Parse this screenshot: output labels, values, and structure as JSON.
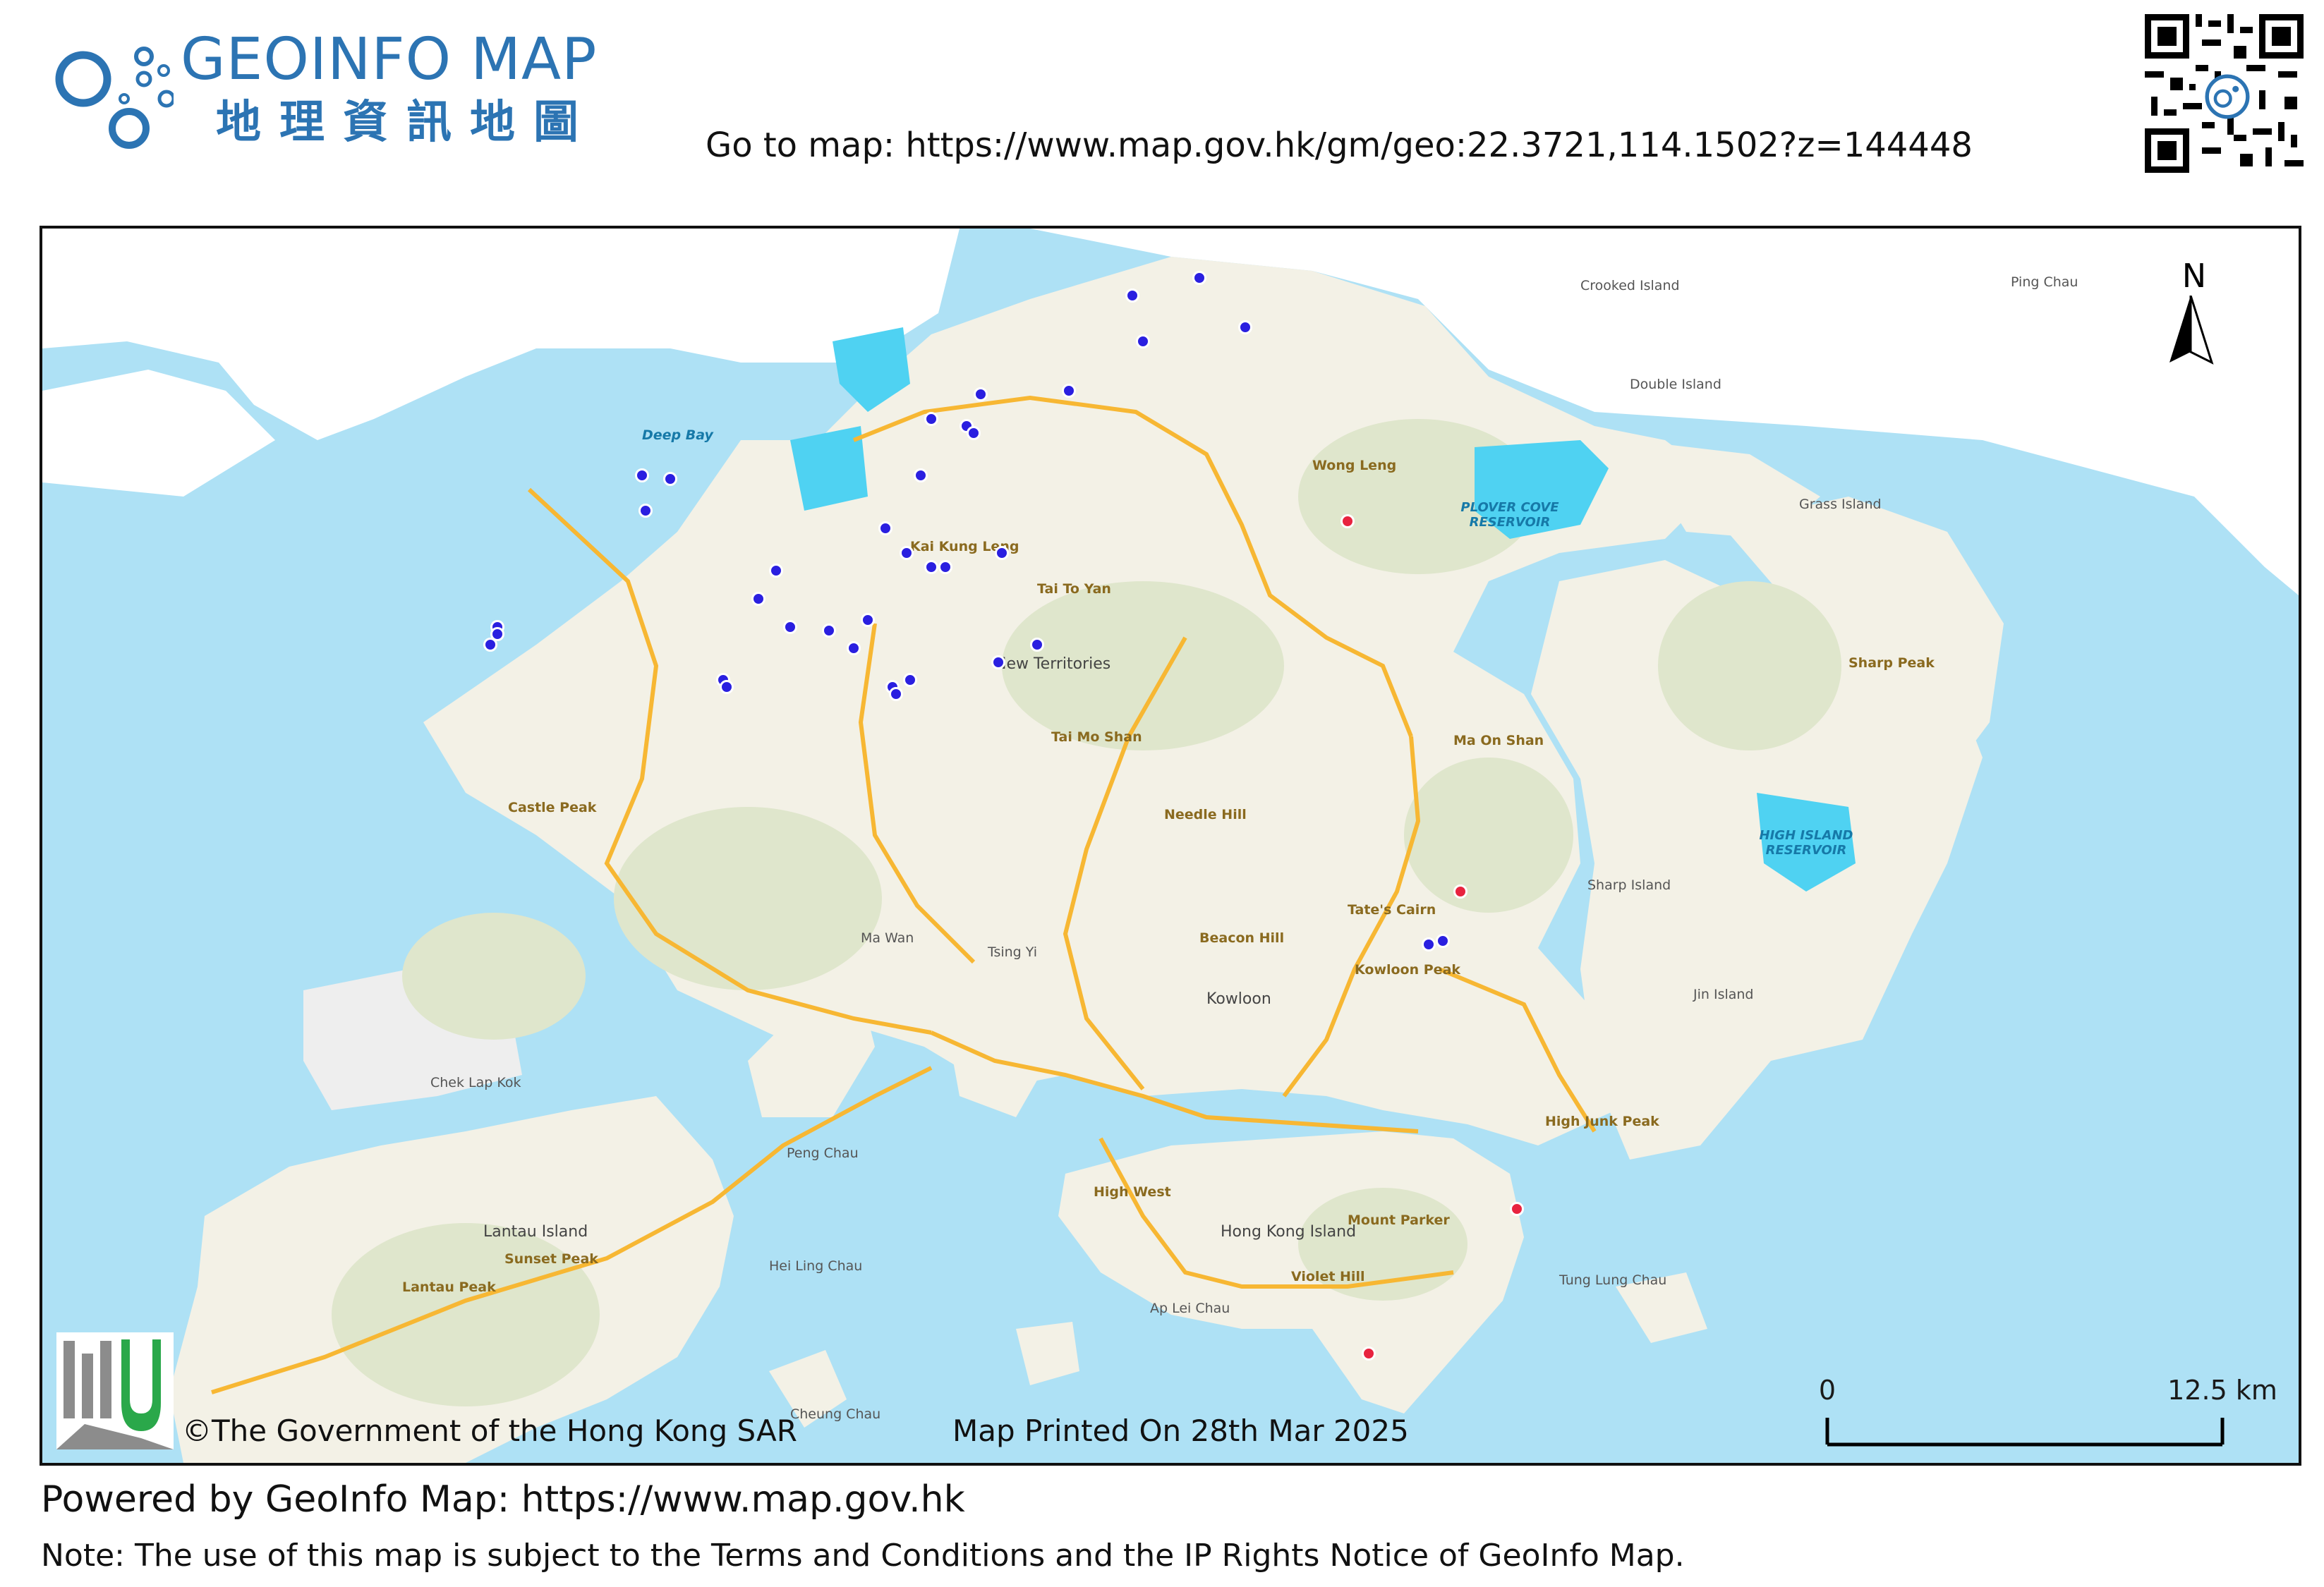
{
  "header": {
    "brand_en": "GEOINFO MAP",
    "brand_zh": "地理資訊地圖",
    "goto_label": "Go to map: https://www.map.gov.hk/gm/geo:22.3721,114.1502?z=144448",
    "qr_icon": "qr-code-icon"
  },
  "colors": {
    "brand": "#2c74b3",
    "sea": "#aee1f5",
    "land": "#f3f1e6",
    "green_hill": "#dfe6cc",
    "reservoir": "#4fd2f2",
    "road": "#f7b733",
    "blue_marker": "#2a1fe0",
    "red_marker": "#e8233f"
  },
  "map": {
    "labels": [
      {
        "text": "Deep Bay",
        "kind": "water"
      },
      {
        "text": "Kai Kung Leng",
        "kind": "peak"
      },
      {
        "text": "Tai To Yan",
        "kind": "peak"
      },
      {
        "text": "New Territories",
        "kind": "big"
      },
      {
        "text": "Tai Mo Shan",
        "kind": "peak"
      },
      {
        "text": "Castle Peak",
        "kind": "peak"
      },
      {
        "text": "Wong Leng",
        "kind": "peak"
      },
      {
        "text": "PLOVER COVE RESERVOIR",
        "kind": "water"
      },
      {
        "text": "Crooked Island",
        "kind": "place"
      },
      {
        "text": "Double Island",
        "kind": "place"
      },
      {
        "text": "Ping Chau",
        "kind": "place"
      },
      {
        "text": "Grass Island",
        "kind": "place"
      },
      {
        "text": "Sharp Peak",
        "kind": "peak"
      },
      {
        "text": "Ma On Shan",
        "kind": "peak"
      },
      {
        "text": "HIGH ISLAND RESERVOIR",
        "kind": "water"
      },
      {
        "text": "Needle Hill",
        "kind": "peak"
      },
      {
        "text": "Sharp Island",
        "kind": "place"
      },
      {
        "text": "Tate's Cairn",
        "kind": "peak"
      },
      {
        "text": "Beacon Hill",
        "kind": "peak"
      },
      {
        "text": "Kowloon Peak",
        "kind": "peak"
      },
      {
        "text": "Kowloon",
        "kind": "big"
      },
      {
        "text": "Jin Island",
        "kind": "place"
      },
      {
        "text": "Ma Wan",
        "kind": "place"
      },
      {
        "text": "Tsing Yi",
        "kind": "place"
      },
      {
        "text": "Chek Lap Kok",
        "kind": "place"
      },
      {
        "text": "Peng Chau",
        "kind": "place"
      },
      {
        "text": "High Junk Peak",
        "kind": "peak"
      },
      {
        "text": "High West",
        "kind": "peak"
      },
      {
        "text": "Hong Kong Island",
        "kind": "big"
      },
      {
        "text": "Mount Parker",
        "kind": "peak"
      },
      {
        "text": "Lantau Island",
        "kind": "big"
      },
      {
        "text": "Sunset Peak",
        "kind": "peak"
      },
      {
        "text": "Lantau Peak",
        "kind": "peak"
      },
      {
        "text": "Hei Ling Chau",
        "kind": "place"
      },
      {
        "text": "Violet Hill",
        "kind": "peak"
      },
      {
        "text": "Ap Lei Chau",
        "kind": "place"
      },
      {
        "text": "Tung Lung Chau",
        "kind": "place"
      },
      {
        "text": "Cheung Chau",
        "kind": "place"
      }
    ],
    "markers": {
      "blue_count": 36,
      "red_count": 4
    },
    "north_label": "N",
    "scale": {
      "zero": "0",
      "max": "12.5 km"
    },
    "copyright": "©The Government of the Hong Kong SAR",
    "printed": "Map Printed On 28th Mar 2025",
    "lands_logo": "lands-department-logo"
  },
  "footer": {
    "powered": "Powered by GeoInfo Map: https://www.map.gov.hk",
    "note": "Note: The use of this map is subject to the Terms and Conditions and the IP Rights Notice of GeoInfo Map."
  }
}
